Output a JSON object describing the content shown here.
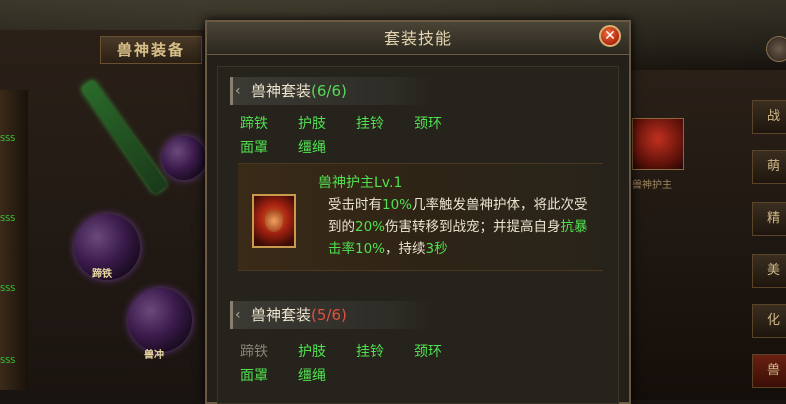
{
  "dialog": {
    "title": "套装技能"
  },
  "background": {
    "left_title": "兽神装备",
    "orb1_label": "蹄铁",
    "orb2_label": "兽冲",
    "strip_values": [
      "SSS",
      "SSS",
      "SSS",
      "SSS"
    ],
    "right_name": "兽神护主",
    "right_tabs": [
      "战",
      "萌",
      "精",
      "美",
      "化",
      "兽"
    ]
  },
  "sets": [
    {
      "name": "兽神套装",
      "count": "(6/6)",
      "count_color": "#58d858",
      "pieces": [
        {
          "label": "蹄铁",
          "active": true
        },
        {
          "label": "护肢",
          "active": true
        },
        {
          "label": "挂铃",
          "active": true
        },
        {
          "label": "颈环",
          "active": true
        },
        {
          "label": "面罩",
          "active": true
        },
        {
          "label": "缰绳",
          "active": true
        }
      ],
      "skill": {
        "icon": "beast-guardian-icon",
        "name": "兽神护主Lv.1",
        "desc_parts": {
          "p1": "受击时有",
          "v1": "10%",
          "p2": "几率触发兽神护体，将此次受到的",
          "v2": "20%",
          "p3": "伤害转移到战宠；并提高自身",
          "v3": "抗暴击率10%",
          "p4": "，持续",
          "v4": "3秒"
        }
      }
    },
    {
      "name": "兽神套装",
      "count": "(5/6)",
      "count_color": "#e05040",
      "pieces": [
        {
          "label": "蹄铁",
          "active": false
        },
        {
          "label": "护肢",
          "active": true
        },
        {
          "label": "挂铃",
          "active": true
        },
        {
          "label": "颈环",
          "active": true
        },
        {
          "label": "面罩",
          "active": true
        },
        {
          "label": "缰绳",
          "active": true
        }
      ]
    }
  ]
}
